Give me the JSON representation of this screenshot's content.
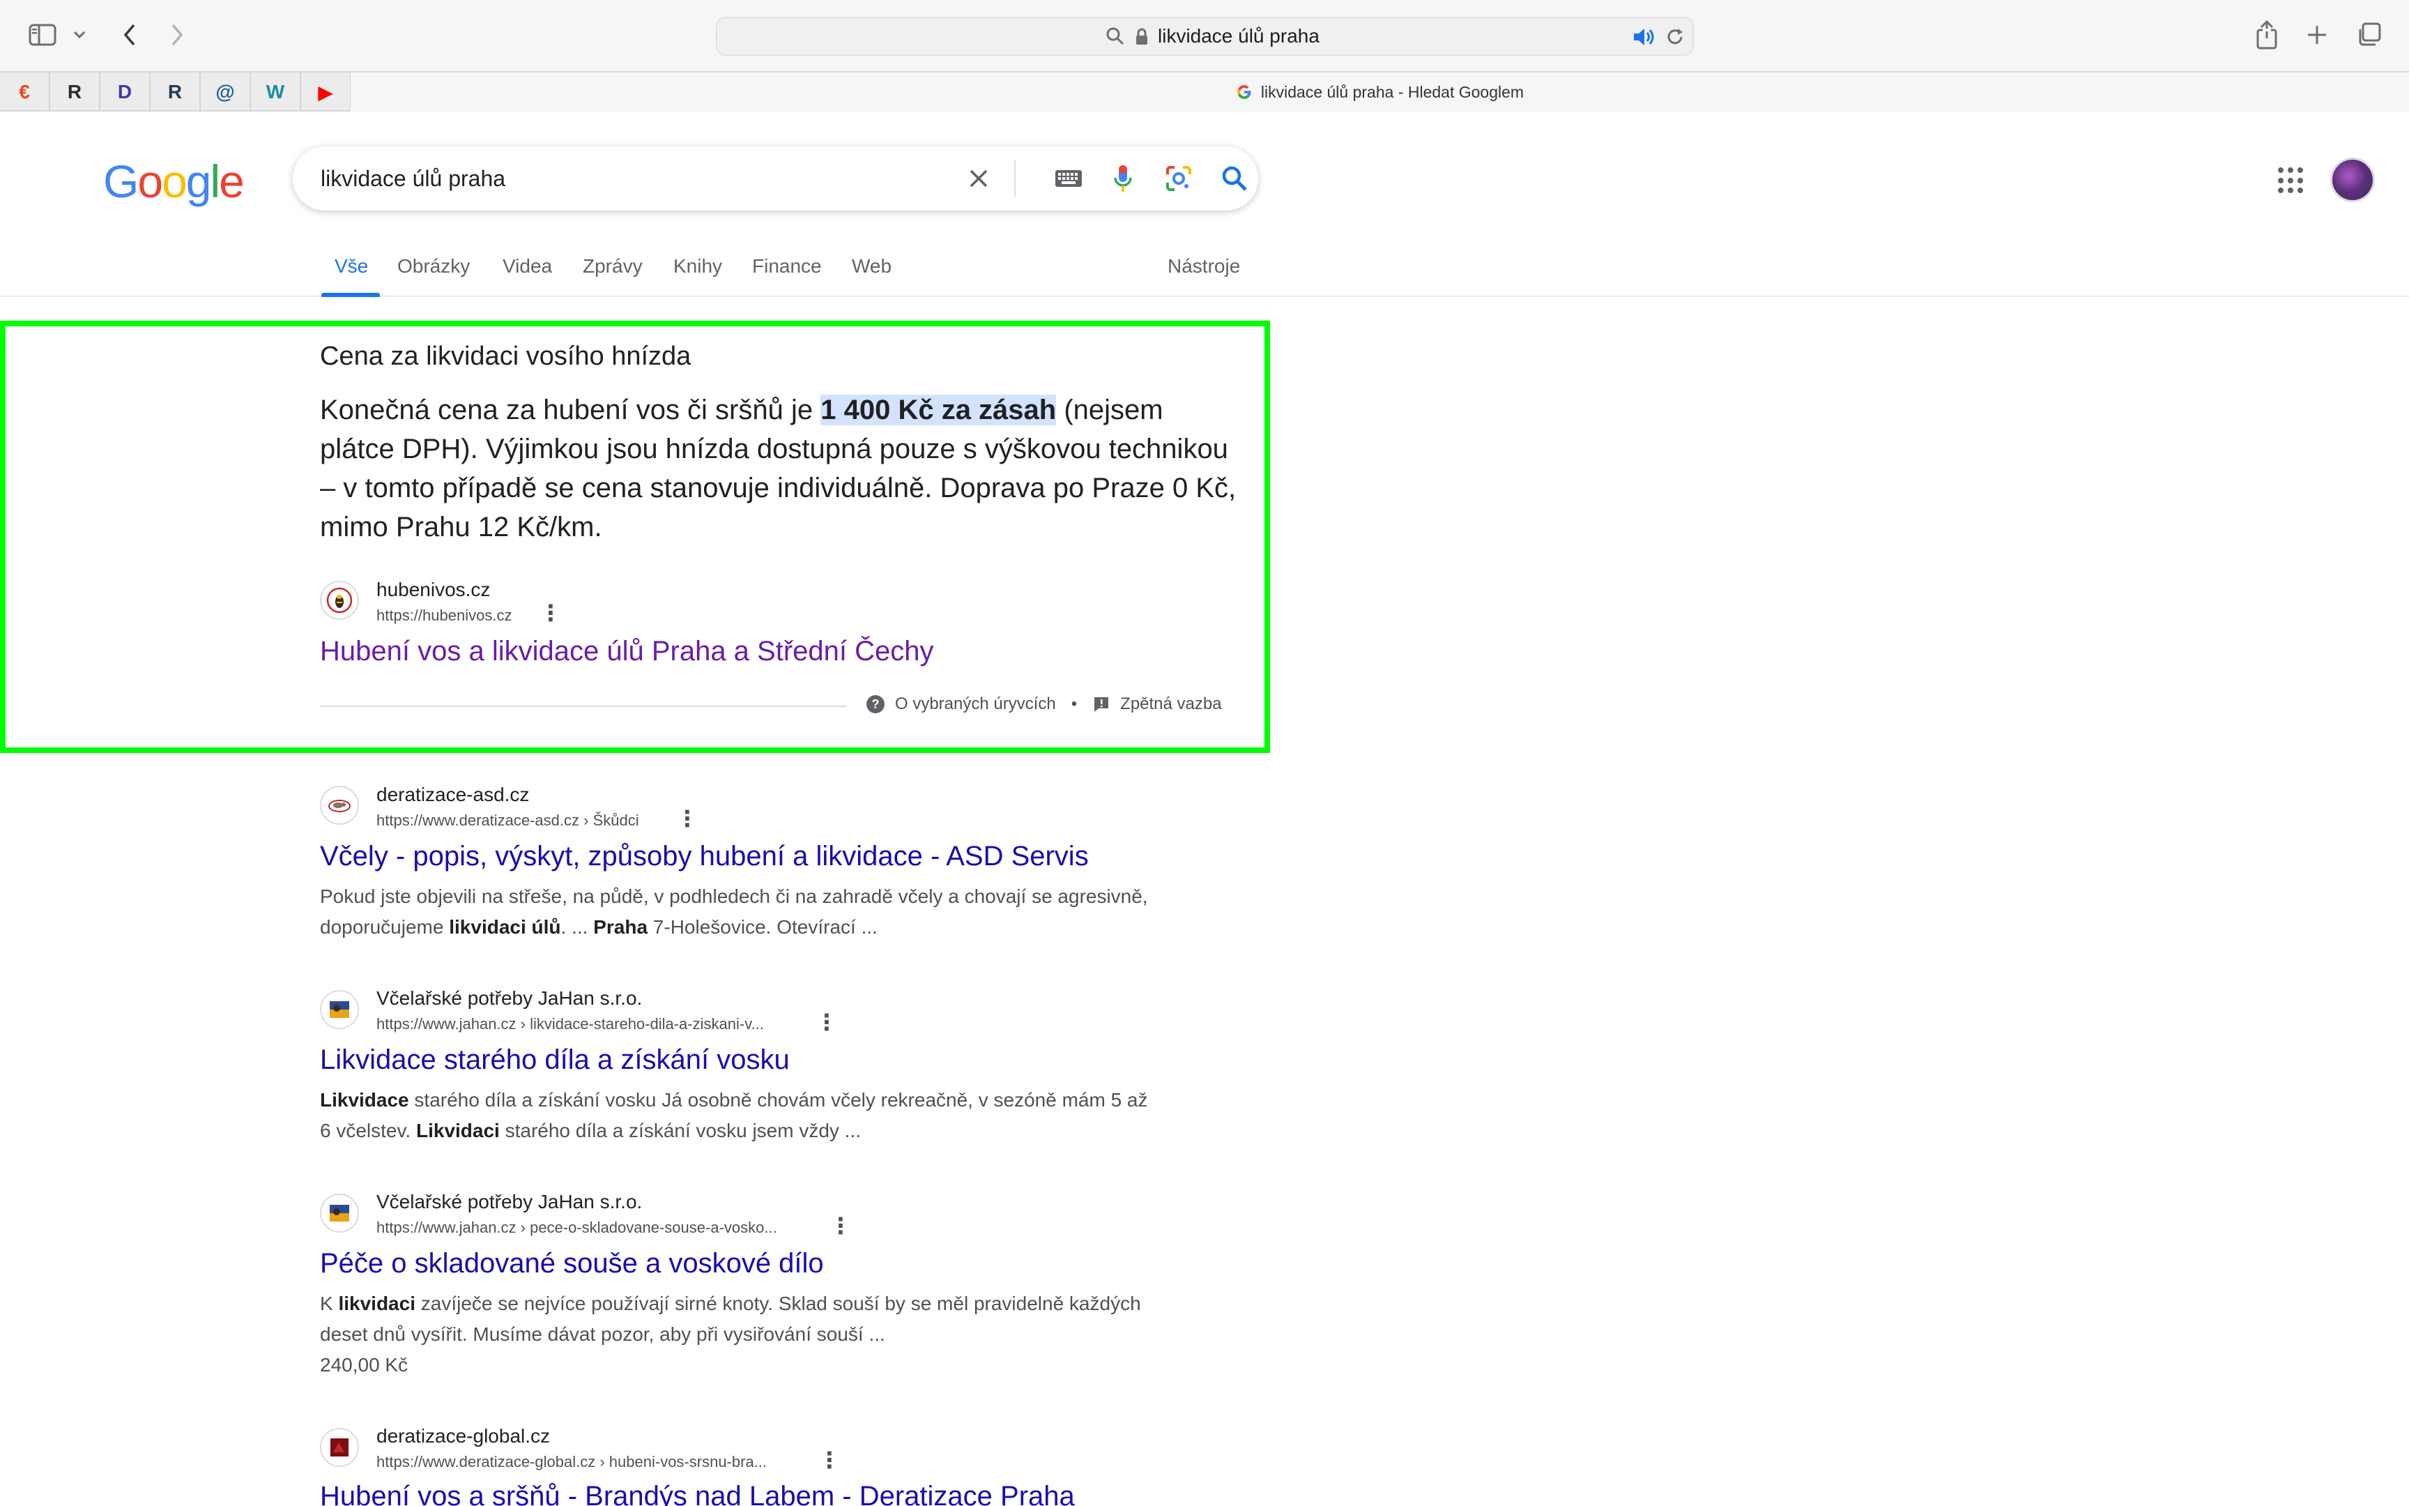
{
  "browser": {
    "address": "likvidace úlů praha",
    "active_tab_title": "likvidace úlů praha - Hledat Googlem",
    "pinned_tabs": [
      {
        "icon": "arrow-tab-icon",
        "label": "€",
        "color": "#e8491d"
      },
      {
        "icon": "green-logo-tab-icon",
        "label": "R",
        "color": "#2c2c2c"
      },
      {
        "icon": "d-tab-icon",
        "label": "D",
        "color": "#3b3aa8"
      },
      {
        "icon": "dark-square-tab-icon",
        "label": "R",
        "color": "#1f3a5a"
      },
      {
        "icon": "at-sign-tab-icon",
        "label": "@",
        "color": "#1a5c9e"
      },
      {
        "icon": "w-tab-icon",
        "label": "W",
        "color": "#1e8aa8"
      },
      {
        "icon": "youtube-tab-icon",
        "label": "▶",
        "color": "#ff0000"
      }
    ]
  },
  "google": {
    "logo": "Google",
    "query": "likvidace úlů praha",
    "tabs": [
      "Vše",
      "Obrázky",
      "Videa",
      "Zprávy",
      "Knihy",
      "Finance",
      "Web"
    ],
    "tools": "Nástroje"
  },
  "snippet": {
    "heading": "Cena za likvidaci vosího hnízda",
    "body_before": "Konečná cena za hubení vos či sršňů je ",
    "body_highlight": "1 400 Kč za zásah",
    "body_after": " (nejsem plátce DPH). Výjimkou jsou hnízda dostupná pouze s výškovou technikou – v tomto případě se cena stanovuje individuálně. Doprava po Praze 0 Kč, mimo Prahu 12 Kč/km.",
    "site_name": "hubenivos.cz",
    "site_url": "https://hubenivos.cz",
    "link_title": "Hubení vos a likvidace úlů Praha a Střední Čechy",
    "footer_about": "O vybraných úryvcích",
    "footer_sep": "•",
    "footer_feedback": "Zpětná vazba"
  },
  "results": [
    {
      "site_name": "deratizace-asd.cz",
      "url": "https://www.deratizace-asd.cz › Škůdci",
      "title": "Včely - popis, výskyt, způsoby hubení a likvidace - ASD Servis",
      "desc_html": "Pokud jste objevili na střeše, na půdě, v podhledech či na zahradě včely a chovají se agresivně, doporučujeme <b>likvidaci úlů</b>. ... <b>Praha</b> 7-Holešovice. Otevírací ..."
    },
    {
      "site_name": "Včelařské potřeby JaHan s.r.o.",
      "url": "https://www.jahan.cz › likvidace-stareho-dila-a-ziskani-v...",
      "title": "Likvidace starého díla a získání vosku",
      "desc_html": "<b>Likvidace</b> starého díla a získání vosku Já osobně chovám včely rekreačně, v sezóně mám 5 až 6 včelstev. <b>Likvidaci</b> starého díla a získání vosku jsem vždy ..."
    },
    {
      "site_name": "Včelařské potřeby JaHan s.r.o.",
      "url": "https://www.jahan.cz › pece-o-skladovane-souse-a-vosko...",
      "title": "Péče o skladované souše a voskové dílo",
      "desc_html": "K <b>likvidaci</b> zavíječe se nejvíce používají sirné knoty. Sklad souší by se měl pravidelně každých deset dnů vysířit. Musíme dávat pozor, aby při vysiřování souší ...",
      "price": "240,00 Kč"
    },
    {
      "site_name": "deratizace-global.cz",
      "url": "https://www.deratizace-global.cz › hubeni-vos-srsnu-bra...",
      "title": "Hubení vos a sršňů - Brandýs nad Labem - Deratizace Praha"
    }
  ]
}
